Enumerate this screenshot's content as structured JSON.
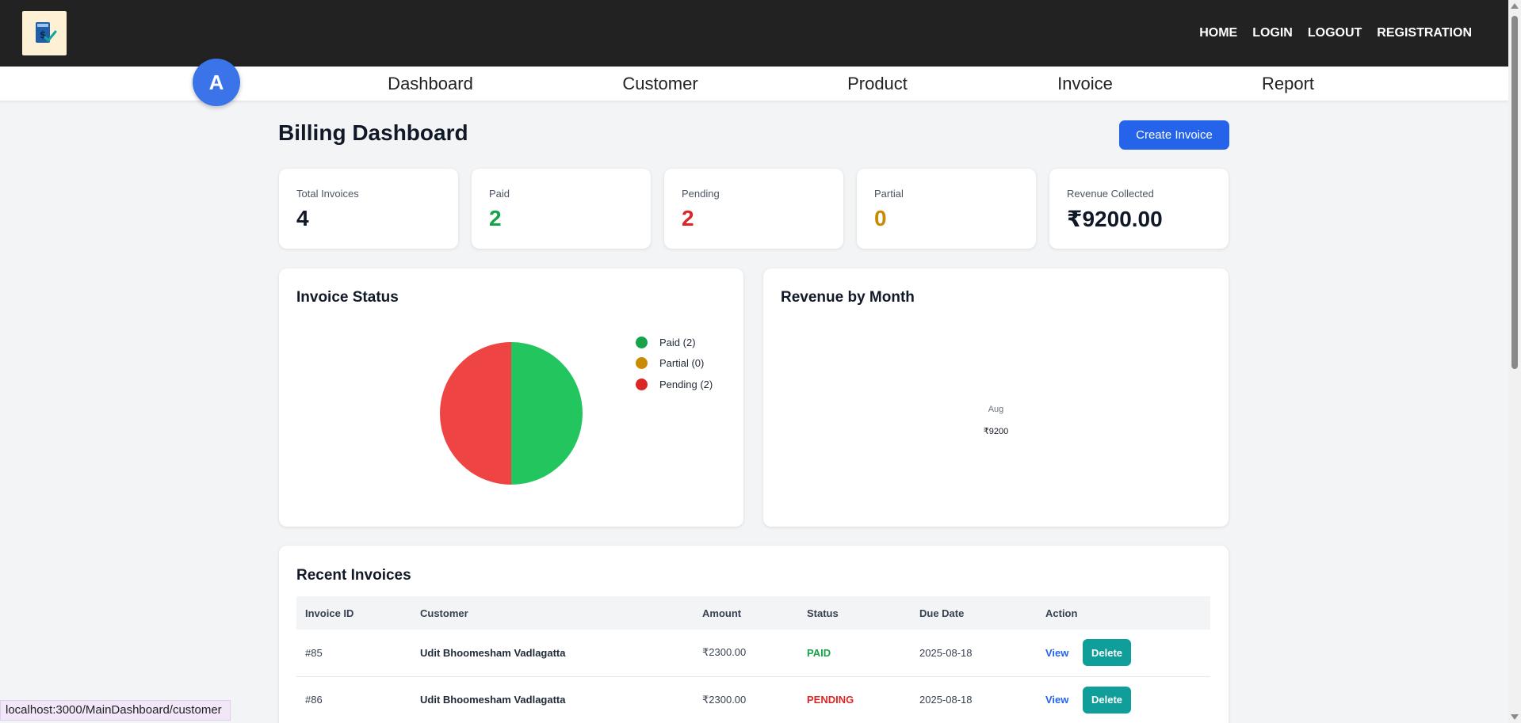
{
  "header": {
    "logo_icon": "invoice-dollar-check-icon",
    "nav": [
      "HOME",
      "LOGIN",
      "LOGOUT",
      "REGISTRATION"
    ]
  },
  "avatar": {
    "initial": "A"
  },
  "subnav": [
    "Dashboard",
    "Customer",
    "Product",
    "Invoice",
    "Report"
  ],
  "page": {
    "title": "Billing Dashboard",
    "create_button": "Create Invoice"
  },
  "stats": [
    {
      "label": "Total Invoices",
      "value": "4",
      "color": "#111827"
    },
    {
      "label": "Paid",
      "value": "2",
      "color": "#16a34a"
    },
    {
      "label": "Pending",
      "value": "2",
      "color": "#dc2626"
    },
    {
      "label": "Partial",
      "value": "0",
      "color": "#ca8a04"
    },
    {
      "label": "Revenue Collected",
      "value": "₹9200.00",
      "color": "#111827"
    }
  ],
  "invoice_status": {
    "title": "Invoice Status",
    "legend": [
      {
        "label": "Paid (2)",
        "color": "#16a34a"
      },
      {
        "label": "Partial (0)",
        "color": "#ca8a04"
      },
      {
        "label": "Pending (2)",
        "color": "#dc2626"
      }
    ]
  },
  "revenue_by_month": {
    "title": "Revenue by Month",
    "month": "Aug",
    "amount": "₹9200"
  },
  "chart_data": [
    {
      "type": "pie",
      "title": "Invoice Status",
      "categories": [
        "Paid",
        "Partial",
        "Pending"
      ],
      "values": [
        2,
        0,
        2
      ],
      "colors": [
        "#22c55e",
        "#ca8a04",
        "#ef4444"
      ],
      "legend": "top-right"
    },
    {
      "type": "bar",
      "title": "Revenue by Month",
      "categories": [
        "Aug"
      ],
      "values": [
        9200
      ]
    }
  ],
  "recent_invoices": {
    "title": "Recent Invoices",
    "columns": [
      "Invoice ID",
      "Customer",
      "Amount",
      "Status",
      "Due Date",
      "Action"
    ],
    "rows": [
      {
        "id": "#85",
        "customer": "Udit Bhoomesham Vadlagatta",
        "amount": "₹2300.00",
        "status": "PAID",
        "status_type": "paid",
        "due": "2025-08-18",
        "view": "View",
        "delete": "Delete"
      },
      {
        "id": "#86",
        "customer": "Udit Bhoomesham Vadlagatta",
        "amount": "₹2300.00",
        "status": "PENDING",
        "status_type": "pending",
        "due": "2025-08-18",
        "view": "View",
        "delete": "Delete"
      }
    ]
  },
  "statusbar": {
    "url": "localhost:3000/MainDashboard/customer"
  }
}
